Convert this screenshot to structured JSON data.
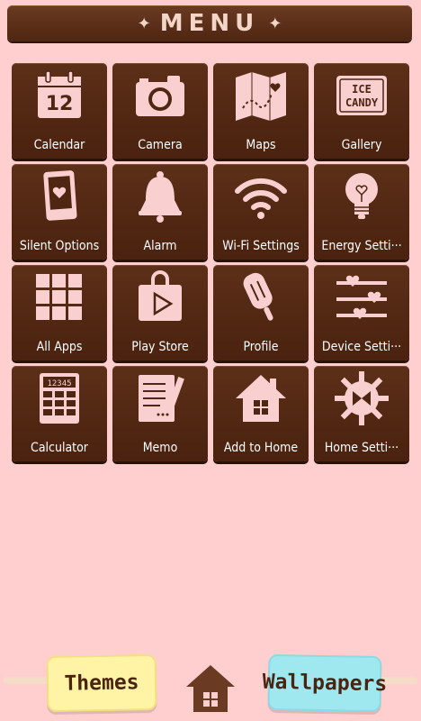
{
  "header": {
    "title": "MENU"
  },
  "tiles": [
    {
      "label": "Calendar",
      "icon": "calendar-icon",
      "number": "12"
    },
    {
      "label": "Camera",
      "icon": "camera-icon"
    },
    {
      "label": "Maps",
      "icon": "map-icon"
    },
    {
      "label": "Gallery",
      "icon": "ice-candy-icon",
      "line1": "ICE",
      "line2": "CANDY"
    },
    {
      "label": "Silent Options",
      "icon": "phone-heart-icon"
    },
    {
      "label": "Alarm",
      "icon": "bell-icon"
    },
    {
      "label": "Wi-Fi Settings",
      "icon": "wifi-icon"
    },
    {
      "label": "Energy Setti···",
      "icon": "lightbulb-icon"
    },
    {
      "label": "All Apps",
      "icon": "grid-icon"
    },
    {
      "label": "Play Store",
      "icon": "shopping-bag-icon"
    },
    {
      "label": "Profile",
      "icon": "popsicle-icon"
    },
    {
      "label": "Device Setti···",
      "icon": "sliders-icon"
    },
    {
      "label": "Calculator",
      "icon": "calculator-icon",
      "display": "12345"
    },
    {
      "label": "Memo",
      "icon": "memo-icon"
    },
    {
      "label": "Add to Home",
      "icon": "house-icon"
    },
    {
      "label": "Home Setti···",
      "icon": "gear-icon"
    }
  ],
  "dock": {
    "themes_label": "Themes",
    "wallpapers_label": "Wallpapers",
    "home_icon": "home-icon"
  },
  "colors": {
    "background": "#ffcfcf",
    "tile": "#4e2612",
    "icon": "#f9cfcf",
    "themes": "#fff4a6",
    "wallpapers": "#9fe8f0"
  }
}
